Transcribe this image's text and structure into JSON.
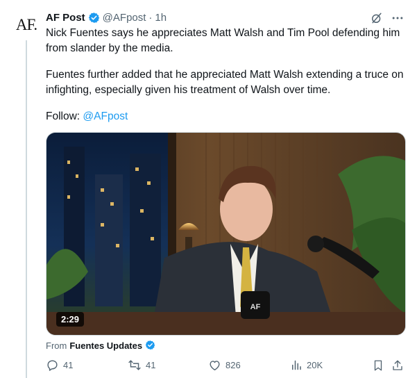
{
  "author": {
    "avatar_text": "AF.",
    "name": "AF Post",
    "handle": "@AFpost",
    "separator": "·",
    "time": "1h"
  },
  "icons": {
    "verified": "verified-badge-icon",
    "grok": "grok-icon",
    "more": "more-icon",
    "reply": "reply-icon",
    "retweet": "retweet-icon",
    "like": "like-icon",
    "views": "views-icon",
    "bookmark": "bookmark-icon",
    "share": "share-icon"
  },
  "colors": {
    "accent": "#1d9bf0",
    "muted": "#536471",
    "text": "#0f1419"
  },
  "tweet": {
    "paragraph1": "Nick Fuentes says he appreciates Matt Walsh and Tim Pool defending him from slander by the media.",
    "paragraph2": "Fuentes further added that he appreciated Matt Walsh extending a truce on infighting, especially given his treatment of Walsh over time.",
    "follow_label": "Follow:",
    "follow_link": "@AFpost"
  },
  "media": {
    "duration": "2:29",
    "mug_logo": "AF"
  },
  "source": {
    "prefix": "From",
    "name": "Fuentes Updates"
  },
  "actions": {
    "replies": "41",
    "retweets": "41",
    "likes": "826",
    "views": "20K"
  }
}
